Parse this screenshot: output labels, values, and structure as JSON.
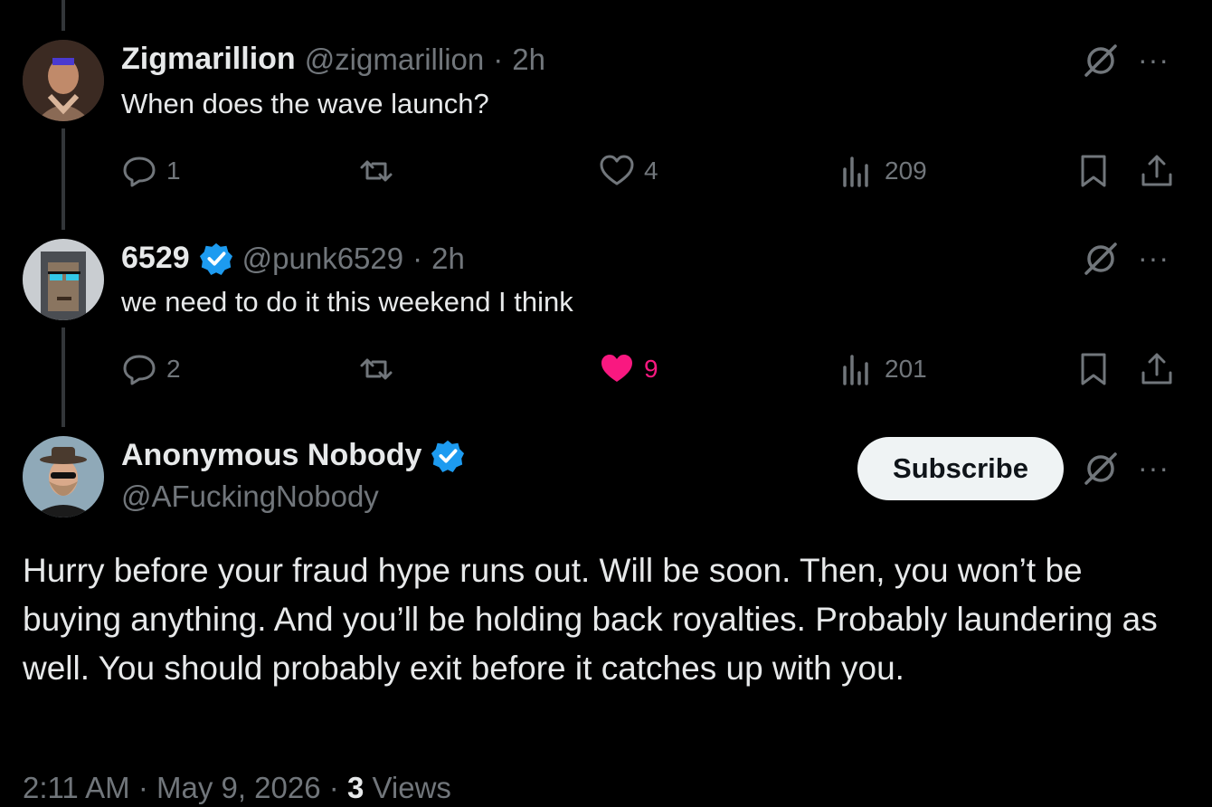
{
  "replies": [
    {
      "display_name": "Zigmarillion",
      "handle": "@zigmarillion",
      "age": "2h",
      "verified": false,
      "text": "When does the wave launch?",
      "reply_count": "1",
      "repost_count": "",
      "like_count": "4",
      "liked": false,
      "view_count": "209"
    },
    {
      "display_name": "6529",
      "handle": "@punk6529",
      "age": "2h",
      "verified": true,
      "text": "we need to do it this weekend I think",
      "reply_count": "2",
      "repost_count": "",
      "like_count": "9",
      "liked": true,
      "view_count": "201"
    }
  ],
  "main": {
    "display_name": "Anonymous Nobody",
    "handle": "@AFuckingNobody",
    "verified": true,
    "subscribe_label": "Subscribe",
    "text": "Hurry before your fraud hype runs out. Will be soon. Then, you won’t be buying anything. And you’ll be holding back royalties. Probably laundering as well. You should probably exit before it catches up with you.",
    "time": "2:11 AM",
    "date": "May 9, 2026",
    "views_count": "3",
    "views_label": "Views"
  },
  "separator": "·",
  "more_label": "···",
  "colors": {
    "background": "#000000",
    "text": "#e7e9ea",
    "muted": "#71767b",
    "like_active": "#f91880",
    "verified": "#1d9bf0",
    "subscribe_bg": "#eff3f4"
  },
  "icons": {
    "reply": "speech-bubble-icon",
    "repost": "repost-arrows-icon",
    "like": "heart-icon",
    "views": "bar-chart-icon",
    "bookmark": "bookmark-icon",
    "share": "share-upload-icon",
    "grok": "grok-slash-circle-icon",
    "more": "more-dots-icon",
    "verified": "verified-badge-icon"
  }
}
